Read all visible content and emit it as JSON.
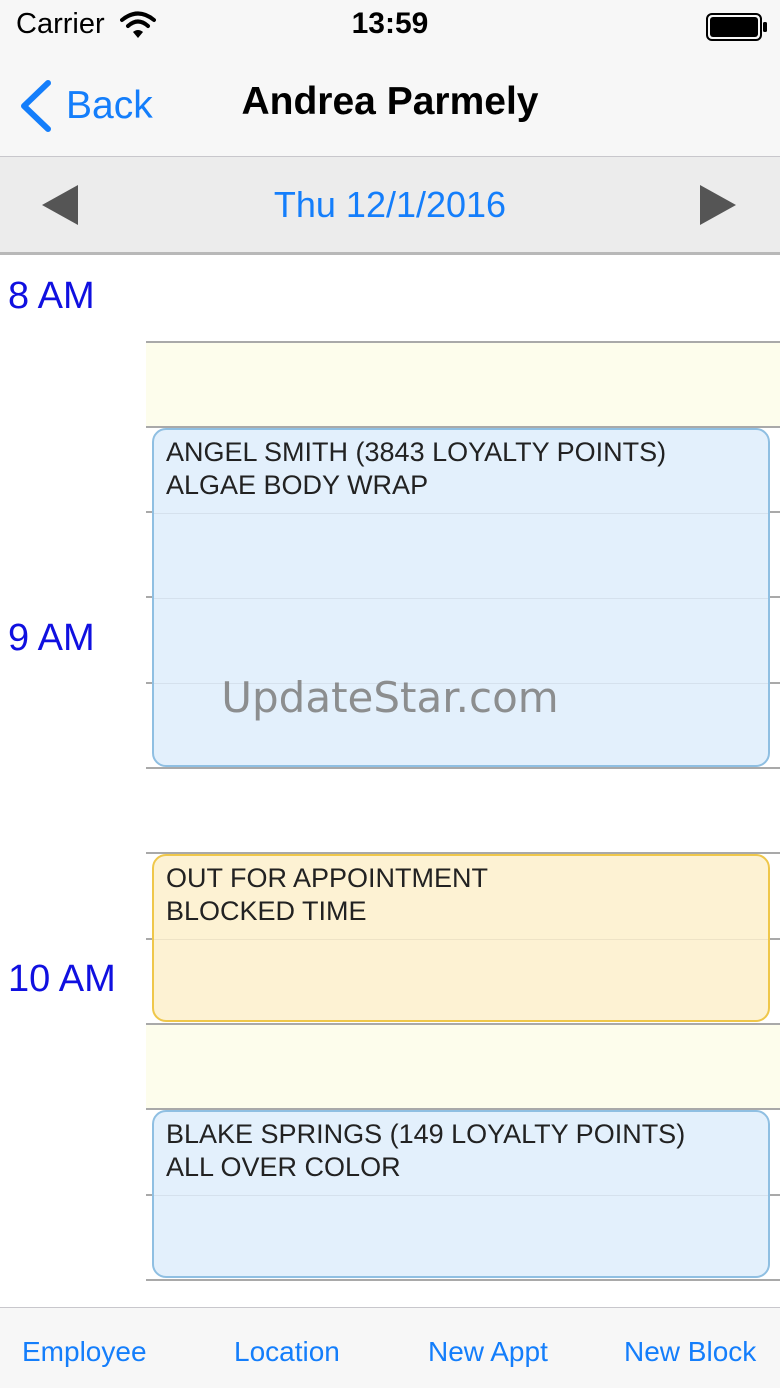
{
  "status_bar": {
    "carrier": "Carrier",
    "time": "13:59",
    "icons": [
      "wifi-icon",
      "battery-icon"
    ]
  },
  "nav": {
    "back_label": "Back",
    "title": "Andrea Parmely",
    "icons": [
      "back-chevron-icon"
    ]
  },
  "date_bar": {
    "date": "Thu 12/1/2016",
    "icons": [
      "prev-day-triangle-icon",
      "next-day-triangle-icon"
    ]
  },
  "schedule": {
    "hours": [
      "8 AM",
      "9 AM",
      "10 AM"
    ],
    "appointments": [
      {
        "line1": "ANGEL SMITH (3843 LOYALTY POINTS)",
        "line2": "ALGAE BODY WRAP",
        "kind": "appointment"
      },
      {
        "line1": "OUT FOR APPOINTMENT",
        "line2": "BLOCKED TIME",
        "kind": "blocked"
      },
      {
        "line1": "BLAKE SPRINGS (149 LOYALTY POINTS)",
        "line2": "ALL OVER COLOR",
        "kind": "appointment"
      }
    ],
    "watermark": "UpdateStar.com"
  },
  "toolbar": {
    "employee": "Employee",
    "location": "Location",
    "new_appt": "New Appt",
    "new_block": "New Block"
  },
  "colors": {
    "accent": "#147efb",
    "hour_label": "#1010e0",
    "appointment_fill": "#e3f0fc",
    "appointment_border": "#8fbfe2",
    "blocked_fill": "#fdf2d3",
    "blocked_border": "#efc74a",
    "open_slot_fill": "#fdfdec"
  }
}
